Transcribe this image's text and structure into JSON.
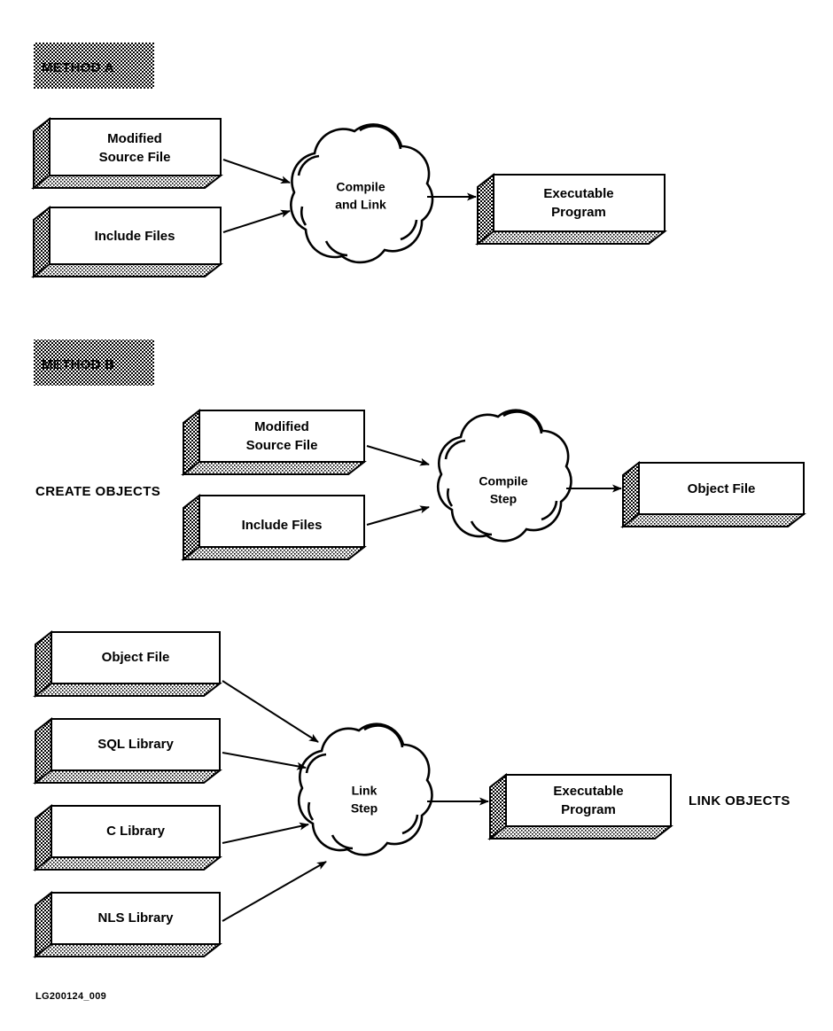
{
  "figure": {
    "id_caption": "LG200124_009",
    "background": "#ffffff",
    "ink": "#000000"
  },
  "sections": [
    {
      "key": "method_a",
      "badge": "METHOD A",
      "side_label": "",
      "process": "Compile and Link"
    },
    {
      "key": "method_b_create",
      "badge": "METHOD B",
      "side_label": "CREATE OBJECTS",
      "process": "Compile Step"
    },
    {
      "key": "method_b_link",
      "badge": "",
      "side_label": "LINK OBJECTS",
      "process": "Link Step"
    }
  ],
  "method_a": {
    "badge": "METHOD A",
    "inputs": [
      {
        "line1": "Modified",
        "line2": "Source File"
      },
      {
        "line1": "Include Files",
        "line2": ""
      }
    ],
    "cloud": {
      "line1": "Compile",
      "line2": "and Link"
    },
    "output": {
      "line1": "Executable",
      "line2": "Program"
    }
  },
  "method_b_create": {
    "badge": "METHOD B",
    "side_label": "CREATE OBJECTS",
    "inputs": [
      {
        "line1": "Modified",
        "line2": "Source File"
      },
      {
        "line1": "Include Files",
        "line2": ""
      }
    ],
    "cloud": {
      "line1": "Compile",
      "line2": "Step"
    },
    "output": {
      "line1": "Object File",
      "line2": ""
    }
  },
  "method_b_link": {
    "side_label": "LINK OBJECTS",
    "inputs": [
      {
        "line1": "Object File",
        "line2": ""
      },
      {
        "line1": "SQL Library",
        "line2": ""
      },
      {
        "line1": "C Library",
        "line2": ""
      },
      {
        "line1": "NLS Library",
        "line2": ""
      }
    ],
    "cloud": {
      "line1": "Link",
      "line2": "Step"
    },
    "output": {
      "line1": "Executable",
      "line2": "Program"
    }
  }
}
